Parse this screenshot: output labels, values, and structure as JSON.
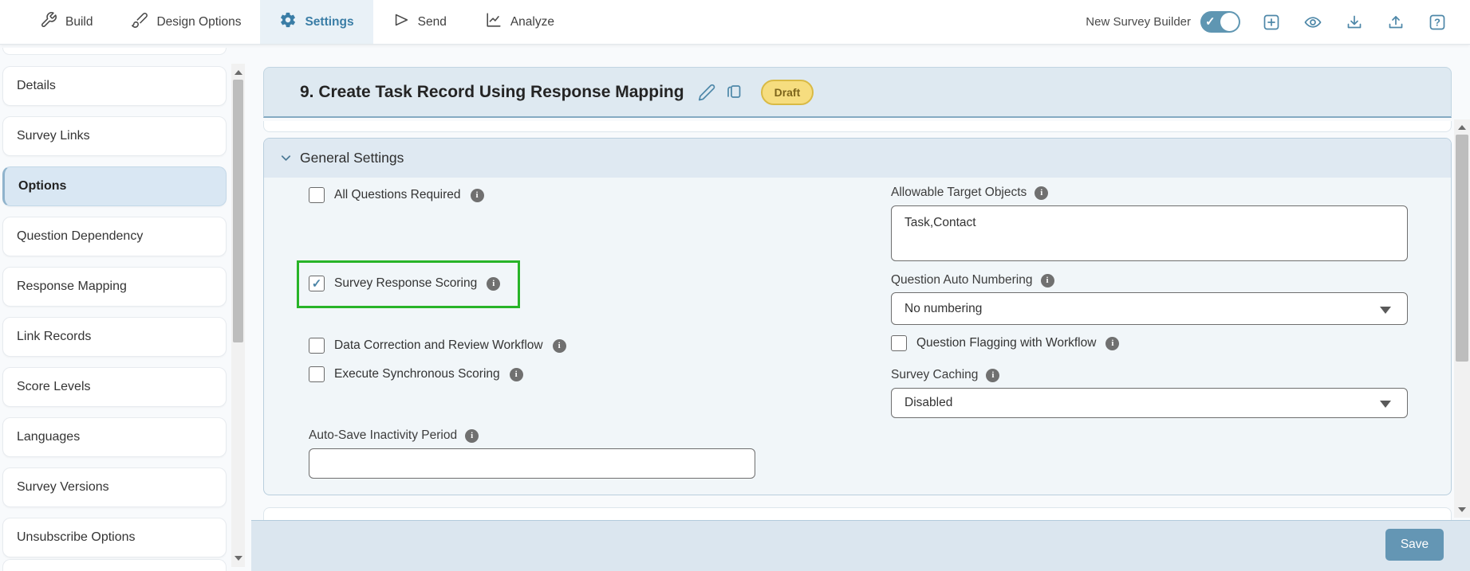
{
  "topbar": {
    "tabs": [
      {
        "label": "Build",
        "active": false
      },
      {
        "label": "Design Options",
        "active": false
      },
      {
        "label": "Settings",
        "active": true
      },
      {
        "label": "Send",
        "active": false
      },
      {
        "label": "Analyze",
        "active": false
      }
    ],
    "toggle": {
      "label": "New Survey Builder",
      "on": true
    }
  },
  "sidebar": {
    "items": [
      {
        "label": "Details",
        "selected": false
      },
      {
        "label": "Survey Links",
        "selected": false
      },
      {
        "label": "Options",
        "selected": true
      },
      {
        "label": "Question Dependency",
        "selected": false
      },
      {
        "label": "Response Mapping",
        "selected": false
      },
      {
        "label": "Link Records",
        "selected": false
      },
      {
        "label": "Score Levels",
        "selected": false
      },
      {
        "label": "Languages",
        "selected": false
      },
      {
        "label": "Survey Versions",
        "selected": false
      },
      {
        "label": "Unsubscribe Options",
        "selected": false
      }
    ]
  },
  "main": {
    "header": {
      "title": "9. Create Task Record Using Response Mapping",
      "badge": "Draft"
    },
    "section": {
      "title": "General Settings"
    },
    "left": {
      "all_questions": {
        "label": "All Questions Required",
        "checked": false
      },
      "response_scoring": {
        "label": "Survey Response Scoring",
        "checked": true,
        "highlighted": true
      },
      "data_correction": {
        "label": "Data Correction and Review Workflow",
        "checked": false
      },
      "sync_scoring": {
        "label": "Execute Synchronous Scoring",
        "checked": false
      },
      "autosave": {
        "label": "Auto-Save Inactivity Period",
        "value": ""
      }
    },
    "right": {
      "target_objects": {
        "label": "Allowable Target Objects",
        "value": "Task,Contact"
      },
      "auto_numbering": {
        "label": "Question Auto Numbering",
        "value": "No numbering"
      },
      "question_flagging": {
        "label": "Question Flagging with Workflow",
        "checked": false
      },
      "survey_caching": {
        "label": "Survey Caching",
        "value": "Disabled"
      }
    },
    "footer": {
      "save_label": "Save"
    }
  },
  "colors": {
    "accent_blue": "#4d87a8",
    "active_tab_blue": "#3a7da6",
    "toggle_teal": "#5f96b2",
    "highlight_green": "#28b428",
    "badge_yellow": "#f6dd7f",
    "save_button_blue": "#6496b4",
    "header_band_blue": "#dee9f1"
  }
}
